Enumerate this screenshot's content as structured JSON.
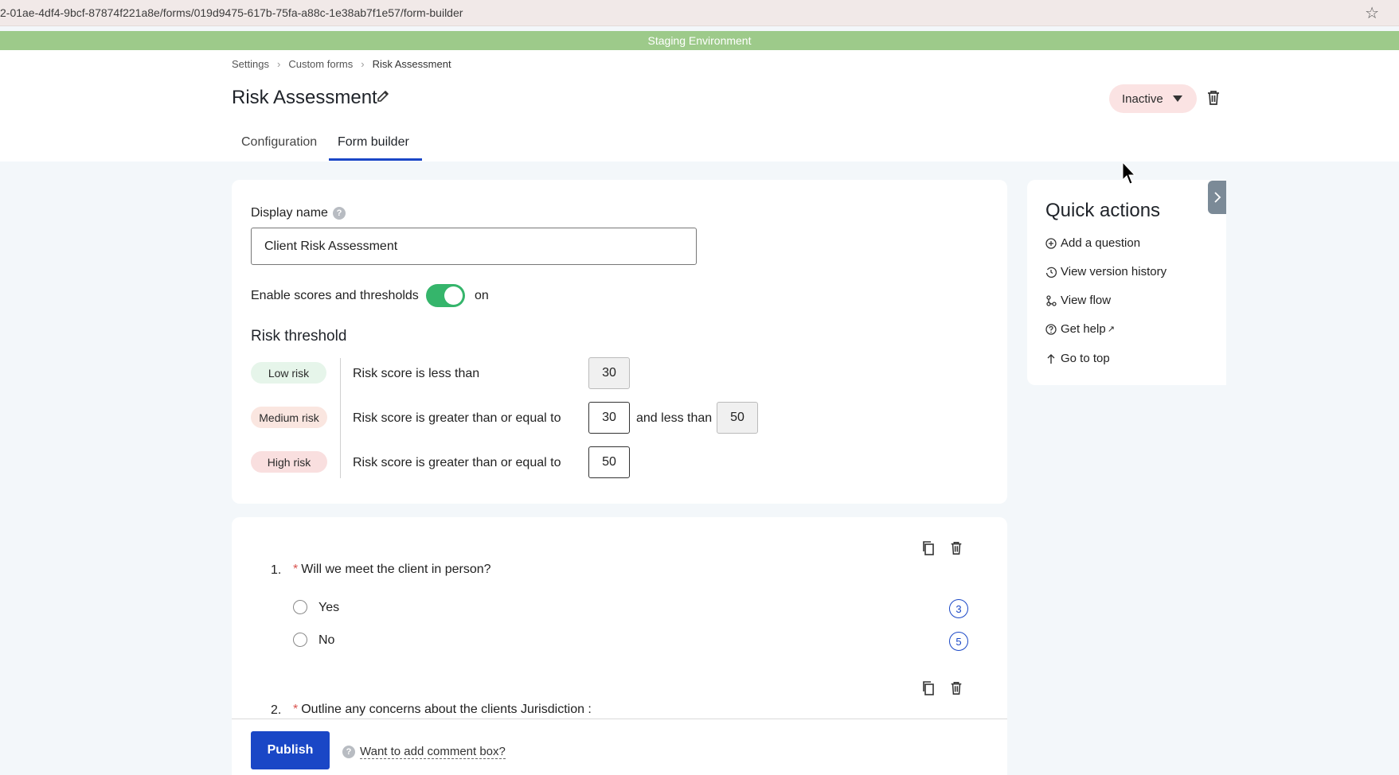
{
  "browser": {
    "url": "2-01ae-4df4-9bcf-87874f221a8e/forms/019d9475-617b-75fa-a88c-1e38ab7f1e57/form-builder"
  },
  "environment_banner": "Staging Environment",
  "breadcrumb": [
    "Settings",
    "Custom forms",
    "Risk Assessment"
  ],
  "page": {
    "title": "Risk Assessment",
    "status": "Inactive"
  },
  "tabs": [
    {
      "label": "Configuration",
      "active": false
    },
    {
      "label": "Form builder",
      "active": true
    }
  ],
  "form": {
    "display_name_label": "Display name",
    "display_name_value": "Client Risk Assessment",
    "enable_scores_label": "Enable scores and thresholds",
    "enable_scores_state": "on",
    "risk_threshold_title": "Risk threshold",
    "thresholds": {
      "low": {
        "badge": "Low risk",
        "rule": "Risk score is less than",
        "value": "30"
      },
      "medium": {
        "badge": "Medium risk",
        "rule": "Risk score is greater than or equal to",
        "value": "30",
        "and_text": "and less than",
        "upper": "50"
      },
      "high": {
        "badge": "High risk",
        "rule": "Risk score is greater than or equal to",
        "value": "50"
      }
    }
  },
  "questions": [
    {
      "number": "1.",
      "text": "Will we meet the client in person?",
      "options": [
        {
          "label": "Yes",
          "score": "3"
        },
        {
          "label": "No",
          "score": "5"
        }
      ]
    },
    {
      "number": "2.",
      "text": "Outline any concerns about the clients Jurisdiction :"
    }
  ],
  "footer": {
    "publish_label": "Publish",
    "comment_box_link": "Want to add comment box?"
  },
  "quick_actions": {
    "title": "Quick actions",
    "items": [
      {
        "label": "Add a question",
        "icon": "plus-circle-icon"
      },
      {
        "label": "View version history",
        "icon": "history-icon"
      },
      {
        "label": "View flow",
        "icon": "flow-icon"
      },
      {
        "label": "Get help",
        "icon": "help-circle-icon"
      },
      {
        "label": "Go to top",
        "icon": "arrow-up-icon"
      }
    ]
  },
  "colors": {
    "primary": "#1a47c6",
    "env_banner": "#9dca8a",
    "toggle_on": "#35b56b",
    "status_pill": "#fbe3e3"
  }
}
